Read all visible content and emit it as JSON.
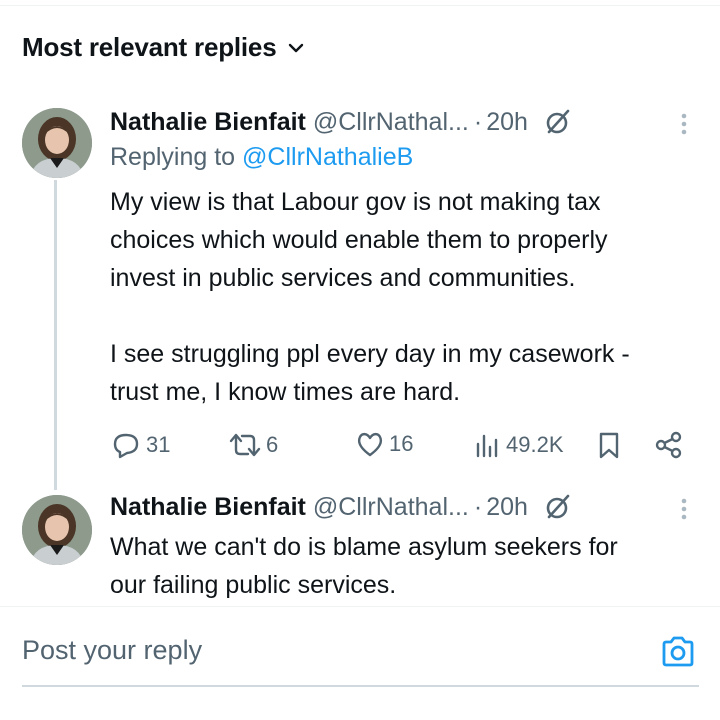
{
  "header": {
    "sort_label": "Most relevant replies"
  },
  "tweets": [
    {
      "author": "Nathalie Bienfait",
      "handle": "@CllrNathal...",
      "separator": "·",
      "time": "20h",
      "replying_prefix": "Replying to ",
      "replying_to": "@CllrNathalieB",
      "text": "My view is that Labour gov is not making tax\nchoices which would enable them to properly\ninvest in public services and communities.\n\nI see struggling ppl every day in my casework -\ntrust me, I know times are hard.",
      "replies": "31",
      "reposts": "6",
      "likes": "16",
      "views": "49.2K"
    },
    {
      "author": "Nathalie Bienfait",
      "handle": "@CllrNathal...",
      "separator": "·",
      "time": "20h",
      "text": "What we can't do is blame asylum seekers for\nour failing public services."
    }
  ],
  "composer": {
    "placeholder": "Post your reply"
  },
  "colors": {
    "accent": "#1d9bf0",
    "secondary_text": "#536471",
    "primary_text": "#0f1419"
  }
}
